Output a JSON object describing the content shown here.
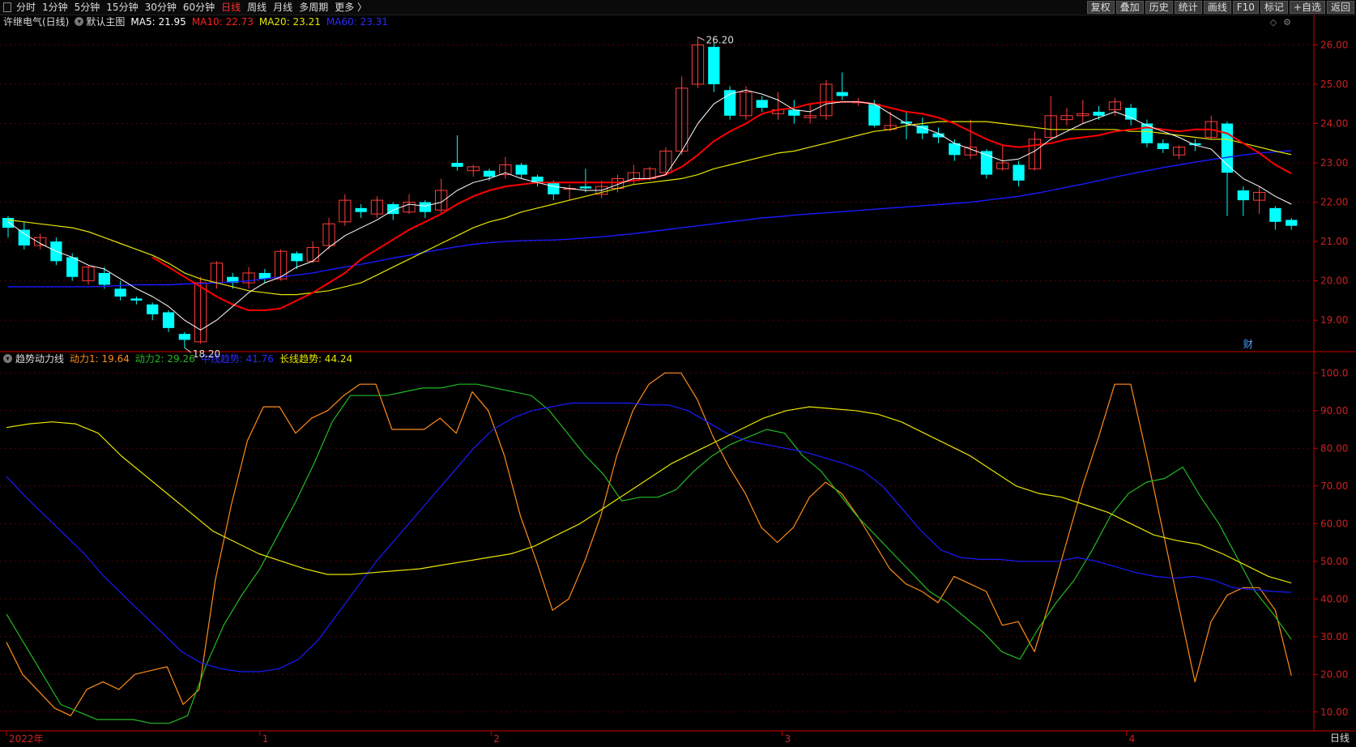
{
  "toolbar": {
    "periods": [
      "分时",
      "1分钟",
      "5分钟",
      "15分钟",
      "30分钟",
      "60分钟",
      "日线",
      "周线",
      "月线",
      "多周期",
      "更多 〉"
    ],
    "active_period": "日线",
    "right": [
      "复权",
      "叠加",
      "历史",
      "统计",
      "画线",
      "F10",
      "标记",
      "+自选",
      "返回"
    ]
  },
  "main_info": {
    "title": "许继电气(日线)",
    "template": "默认主图",
    "ma5": "MA5: 21.95",
    "ma10": "MA10: 22.73",
    "ma20": "MA20: 23.21",
    "ma60": "MA60: 23.31"
  },
  "sub_info": {
    "title": "趋势动力线",
    "d1": "动力1: 19.64",
    "d2": "动力2: 29.26",
    "mid": "中线趋势: 41.76",
    "long": "长线趋势: 44.24"
  },
  "bottom_right_label": "日线",
  "cai_label": "财",
  "colors": {
    "up": "#ff3d3d",
    "down": "#00ffff",
    "ma5": "#ffffff",
    "ma10": "#ff0000",
    "ma20": "#e6e600",
    "ma60": "#1a1aff",
    "d1": "#ff8c1a",
    "d2": "#22bb22",
    "mid": "#1a1aff",
    "long": "#e6e600",
    "axis": "#cc0000"
  },
  "chart_data": [
    {
      "type": "candlestick",
      "ylim": [
        18.2,
        26.4
      ],
      "yticks": [
        "19.00",
        "20.00",
        "21.00",
        "22.00",
        "23.00",
        "24.00",
        "25.00",
        "26.00"
      ],
      "x_labels": [
        "2022年",
        "1",
        "2",
        "3",
        "4"
      ],
      "annotations": [
        {
          "text": "26.20"
        },
        {
          "text": "18.20"
        }
      ],
      "candles": [
        [
          21.6,
          21.35,
          21.65,
          21.1
        ],
        [
          21.3,
          20.9,
          21.5,
          20.8
        ],
        [
          20.9,
          21.1,
          21.2,
          20.8
        ],
        [
          21.0,
          20.5,
          21.1,
          20.4
        ],
        [
          20.6,
          20.1,
          20.7,
          20.0
        ],
        [
          20.0,
          20.35,
          20.4,
          19.9
        ],
        [
          20.2,
          19.9,
          20.35,
          19.8
        ],
        [
          19.8,
          19.6,
          20.0,
          19.5
        ],
        [
          19.55,
          19.5,
          19.6,
          19.4
        ],
        [
          19.4,
          19.15,
          19.45,
          19.0
        ],
        [
          19.2,
          18.8,
          19.25,
          18.7
        ],
        [
          18.65,
          18.5,
          18.7,
          18.3
        ],
        [
          18.45,
          19.95,
          20.1,
          18.4
        ],
        [
          19.95,
          20.45,
          20.5,
          19.8
        ],
        [
          20.1,
          19.95,
          20.2,
          19.8
        ],
        [
          19.95,
          20.2,
          20.35,
          19.8
        ],
        [
          20.2,
          20.05,
          20.3,
          19.95
        ],
        [
          20.05,
          20.75,
          20.8,
          20.0
        ],
        [
          20.7,
          20.5,
          20.75,
          20.3
        ],
        [
          20.5,
          20.85,
          21.0,
          20.45
        ],
        [
          20.9,
          21.45,
          21.6,
          20.8
        ],
        [
          21.5,
          22.05,
          22.2,
          21.4
        ],
        [
          21.85,
          21.75,
          21.95,
          21.6
        ],
        [
          21.7,
          22.05,
          22.15,
          21.6
        ],
        [
          21.95,
          21.7,
          22.0,
          21.55
        ],
        [
          21.75,
          22.0,
          22.2,
          21.7
        ],
        [
          22.0,
          21.75,
          22.05,
          21.6
        ],
        [
          21.8,
          22.3,
          22.6,
          21.7
        ],
        [
          23.0,
          22.9,
          23.7,
          22.8
        ],
        [
          22.8,
          22.9,
          22.95,
          22.65
        ],
        [
          22.8,
          22.65,
          22.85,
          22.55
        ],
        [
          22.7,
          22.95,
          23.15,
          22.6
        ],
        [
          22.95,
          22.7,
          23.0,
          22.6
        ],
        [
          22.65,
          22.5,
          22.7,
          22.4
        ],
        [
          22.5,
          22.2,
          22.55,
          22.05
        ],
        [
          22.35,
          22.35,
          22.45,
          22.05
        ],
        [
          22.4,
          22.35,
          22.85,
          22.25
        ],
        [
          22.2,
          22.4,
          22.55,
          22.1
        ],
        [
          22.35,
          22.6,
          22.7,
          22.25
        ],
        [
          22.55,
          22.75,
          22.95,
          22.45
        ],
        [
          22.6,
          22.85,
          22.9,
          22.55
        ],
        [
          22.75,
          23.3,
          23.4,
          22.7
        ],
        [
          23.3,
          24.9,
          25.2,
          23.2
        ],
        [
          25.0,
          26.0,
          26.2,
          24.9
        ],
        [
          25.95,
          25.0,
          26.05,
          24.8
        ],
        [
          24.85,
          24.2,
          24.95,
          24.1
        ],
        [
          24.2,
          24.8,
          24.95,
          24.1
        ],
        [
          24.6,
          24.4,
          24.7,
          24.3
        ],
        [
          24.25,
          24.35,
          24.8,
          24.1
        ],
        [
          24.35,
          24.2,
          24.6,
          24.0
        ],
        [
          24.15,
          24.2,
          24.5,
          24.0
        ],
        [
          24.2,
          25.0,
          25.1,
          24.1
        ],
        [
          24.8,
          24.7,
          25.3,
          24.6
        ],
        [
          24.55,
          24.55,
          24.65,
          24.45
        ],
        [
          24.5,
          23.95,
          24.6,
          23.9
        ],
        [
          23.85,
          23.95,
          24.3,
          23.8
        ],
        [
          24.05,
          24.0,
          24.3,
          23.6
        ],
        [
          23.95,
          23.75,
          24.15,
          23.6
        ],
        [
          23.75,
          23.65,
          23.9,
          23.5
        ],
        [
          23.5,
          23.2,
          23.6,
          23.05
        ],
        [
          23.2,
          23.4,
          24.1,
          23.1
        ],
        [
          23.3,
          22.7,
          23.35,
          22.6
        ],
        [
          22.85,
          23.0,
          23.45,
          22.8
        ],
        [
          22.95,
          22.55,
          23.05,
          22.4
        ],
        [
          22.85,
          23.6,
          23.8,
          22.8
        ],
        [
          23.65,
          24.2,
          24.7,
          23.6
        ],
        [
          24.1,
          24.2,
          24.4,
          23.95
        ],
        [
          24.2,
          24.25,
          24.6,
          24.0
        ],
        [
          24.3,
          24.2,
          24.45,
          24.1
        ],
        [
          24.35,
          24.55,
          24.65,
          24.2
        ],
        [
          24.4,
          24.1,
          24.5,
          23.95
        ],
        [
          24.0,
          23.5,
          24.1,
          23.4
        ],
        [
          23.5,
          23.35,
          23.6,
          23.25
        ],
        [
          23.2,
          23.4,
          23.45,
          23.1
        ],
        [
          23.5,
          23.45,
          23.6,
          23.3
        ],
        [
          23.65,
          24.05,
          24.2,
          23.6
        ],
        [
          24.0,
          22.75,
          24.05,
          21.65
        ],
        [
          22.3,
          22.05,
          22.4,
          21.65
        ],
        [
          22.05,
          22.25,
          22.4,
          21.7
        ],
        [
          21.85,
          21.5,
          21.9,
          21.3
        ],
        [
          21.55,
          21.4,
          21.6,
          21.3
        ]
      ],
      "ma5": [
        21.5,
        21.2,
        20.95,
        20.75,
        20.6,
        20.4,
        20.3,
        20.05,
        19.8,
        19.6,
        19.35,
        19.0,
        18.75,
        19.0,
        19.35,
        19.7,
        19.95,
        20.1,
        20.35,
        20.5,
        20.85,
        21.15,
        21.35,
        21.55,
        21.8,
        21.95,
        21.9,
        22.0,
        22.3,
        22.5,
        22.6,
        22.75,
        22.6,
        22.5,
        22.4,
        22.35,
        22.3,
        22.3,
        22.45,
        22.6,
        22.6,
        22.7,
        23.3,
        24.0,
        24.5,
        24.75,
        24.85,
        24.75,
        24.6,
        24.35,
        24.3,
        24.5,
        24.55,
        24.55,
        24.5,
        24.25,
        24.0,
        23.9,
        23.75,
        23.5,
        23.35,
        23.2,
        23.05,
        23.1,
        23.3,
        23.6,
        23.8,
        24.0,
        24.15,
        24.3,
        24.15,
        23.95,
        23.8,
        23.65,
        23.45,
        23.35,
        22.95,
        22.6,
        22.4,
        22.15,
        21.95
      ],
      "ma10": [
        null,
        null,
        null,
        null,
        null,
        null,
        null,
        null,
        null,
        20.6,
        20.35,
        20.1,
        19.85,
        19.6,
        19.4,
        19.25,
        19.25,
        19.3,
        19.5,
        19.7,
        19.95,
        20.2,
        20.55,
        20.8,
        21.05,
        21.3,
        21.5,
        21.7,
        21.95,
        22.15,
        22.3,
        22.4,
        22.45,
        22.5,
        22.5,
        22.5,
        22.5,
        22.5,
        22.5,
        22.55,
        22.6,
        22.7,
        22.9,
        23.2,
        23.55,
        23.8,
        24.0,
        24.25,
        24.35,
        24.4,
        24.5,
        24.55,
        24.55,
        24.55,
        24.5,
        24.4,
        24.3,
        24.25,
        24.15,
        24.0,
        23.8,
        23.6,
        23.45,
        23.4,
        23.45,
        23.5,
        23.6,
        23.65,
        23.7,
        23.8,
        23.85,
        23.9,
        23.85,
        23.8,
        23.85,
        23.85,
        23.75,
        23.5,
        23.25,
        22.95,
        22.73
      ],
      "ma20": [
        21.55,
        21.5,
        21.45,
        21.4,
        21.35,
        21.25,
        21.1,
        20.95,
        20.8,
        20.65,
        20.45,
        20.2,
        20.05,
        19.95,
        19.85,
        19.75,
        19.7,
        19.65,
        19.65,
        19.7,
        19.75,
        19.85,
        19.95,
        20.15,
        20.35,
        20.55,
        20.75,
        20.95,
        21.15,
        21.35,
        21.5,
        21.6,
        21.75,
        21.85,
        21.95,
        22.05,
        22.15,
        22.25,
        22.35,
        22.45,
        22.5,
        22.55,
        22.6,
        22.7,
        22.85,
        22.95,
        23.05,
        23.15,
        23.25,
        23.3,
        23.4,
        23.5,
        23.6,
        23.7,
        23.8,
        23.85,
        23.95,
        24.0,
        24.05,
        24.05,
        24.05,
        24.05,
        24.0,
        23.95,
        23.9,
        23.85,
        23.85,
        23.85,
        23.85,
        23.85,
        23.8,
        23.8,
        23.75,
        23.7,
        23.65,
        23.6,
        23.6,
        23.5,
        23.4,
        23.3,
        23.21
      ],
      "ma60": [
        19.85,
        19.85,
        19.85,
        19.85,
        19.85,
        19.85,
        19.86,
        19.88,
        19.9,
        19.9,
        19.9,
        19.92,
        19.93,
        19.95,
        19.97,
        20.0,
        20.05,
        20.1,
        20.15,
        20.2,
        20.28,
        20.35,
        20.42,
        20.5,
        20.58,
        20.65,
        20.73,
        20.8,
        20.87,
        20.93,
        20.97,
        21.0,
        21.02,
        21.03,
        21.04,
        21.06,
        21.09,
        21.12,
        21.16,
        21.2,
        21.25,
        21.3,
        21.35,
        21.4,
        21.45,
        21.5,
        21.55,
        21.6,
        21.63,
        21.67,
        21.7,
        21.73,
        21.76,
        21.79,
        21.82,
        21.85,
        21.88,
        21.91,
        21.94,
        21.97,
        22.0,
        22.05,
        22.1,
        22.15,
        22.22,
        22.3,
        22.38,
        22.46,
        22.55,
        22.64,
        22.72,
        22.8,
        22.88,
        22.95,
        23.02,
        23.08,
        23.14,
        23.2,
        23.25,
        23.28,
        23.31
      ]
    },
    {
      "type": "line",
      "title": "趋势动力线",
      "ylim": [
        5,
        102
      ],
      "yticks": [
        "10.00",
        "20.00",
        "30.00",
        "40.00",
        "50.00",
        "60.00",
        "70.00",
        "80.00",
        "90.00",
        "100.0"
      ],
      "series": [
        {
          "name": "动力1",
          "values": [
            28.5,
            20,
            15.5,
            11,
            9,
            16,
            18,
            16,
            20,
            21,
            22,
            12,
            16,
            45,
            65,
            82,
            91,
            91,
            84,
            88,
            90,
            94,
            97,
            97,
            85,
            85,
            85,
            88,
            84,
            95,
            90,
            78,
            62,
            50,
            37,
            40,
            50,
            62,
            78,
            90,
            97,
            100,
            100,
            93,
            83,
            75,
            68,
            59,
            55,
            59,
            67,
            71,
            68,
            62,
            55,
            48,
            44,
            42,
            39,
            46,
            44,
            42,
            33,
            34,
            26,
            40,
            55,
            70,
            83,
            97,
            97,
            78,
            58,
            38,
            18,
            34,
            41,
            43,
            43,
            37,
            19.64
          ]
        },
        {
          "name": "动力2",
          "values": [
            36,
            28,
            20,
            12,
            10,
            8,
            8,
            8,
            7,
            7,
            9,
            22,
            33,
            41,
            48,
            57,
            66,
            76,
            87,
            94,
            94,
            94,
            95,
            96,
            96,
            97,
            97,
            96,
            95,
            94,
            90,
            84,
            78,
            73,
            66,
            67,
            67,
            69,
            74,
            78,
            81,
            83,
            85,
            84,
            78,
            74,
            68,
            62,
            57,
            52,
            47,
            42,
            39,
            35,
            31,
            26,
            24,
            32,
            39,
            45,
            53,
            62,
            68,
            71,
            72,
            75,
            67,
            60,
            51,
            42,
            36,
            29.26
          ]
        },
        {
          "name": "中线趋势",
          "values": [
            72.5,
            67,
            62,
            57,
            52,
            46,
            41,
            36,
            31,
            26,
            23,
            21.5,
            20.7,
            20.7,
            21.5,
            24,
            29,
            36,
            43,
            50,
            56,
            62,
            68,
            74,
            80,
            85,
            88,
            90,
            91,
            92,
            92,
            92,
            92,
            91.5,
            91.5,
            90,
            87,
            84,
            82,
            81,
            80,
            79,
            77.5,
            76,
            74,
            70,
            64,
            58,
            53,
            51,
            50.5,
            50.5,
            50,
            50,
            50,
            51,
            50,
            48.5,
            47,
            46,
            45.5,
            46,
            45,
            43,
            42.5,
            42,
            41.76
          ]
        },
        {
          "name": "长线趋势",
          "values": [
            85.5,
            86.5,
            87,
            86.5,
            84,
            78,
            73,
            68,
            63,
            58,
            55,
            52,
            50,
            48,
            46.5,
            46.5,
            47,
            47.5,
            48,
            49,
            50,
            51,
            52,
            54,
            57,
            60,
            64,
            68,
            72,
            76,
            79,
            82,
            85,
            88,
            90,
            91,
            90.5,
            90,
            89,
            87,
            84,
            81,
            78,
            74,
            70,
            68,
            67,
            65,
            63,
            60,
            57,
            55.5,
            54.5,
            52,
            49,
            46,
            44.24
          ]
        }
      ]
    }
  ]
}
